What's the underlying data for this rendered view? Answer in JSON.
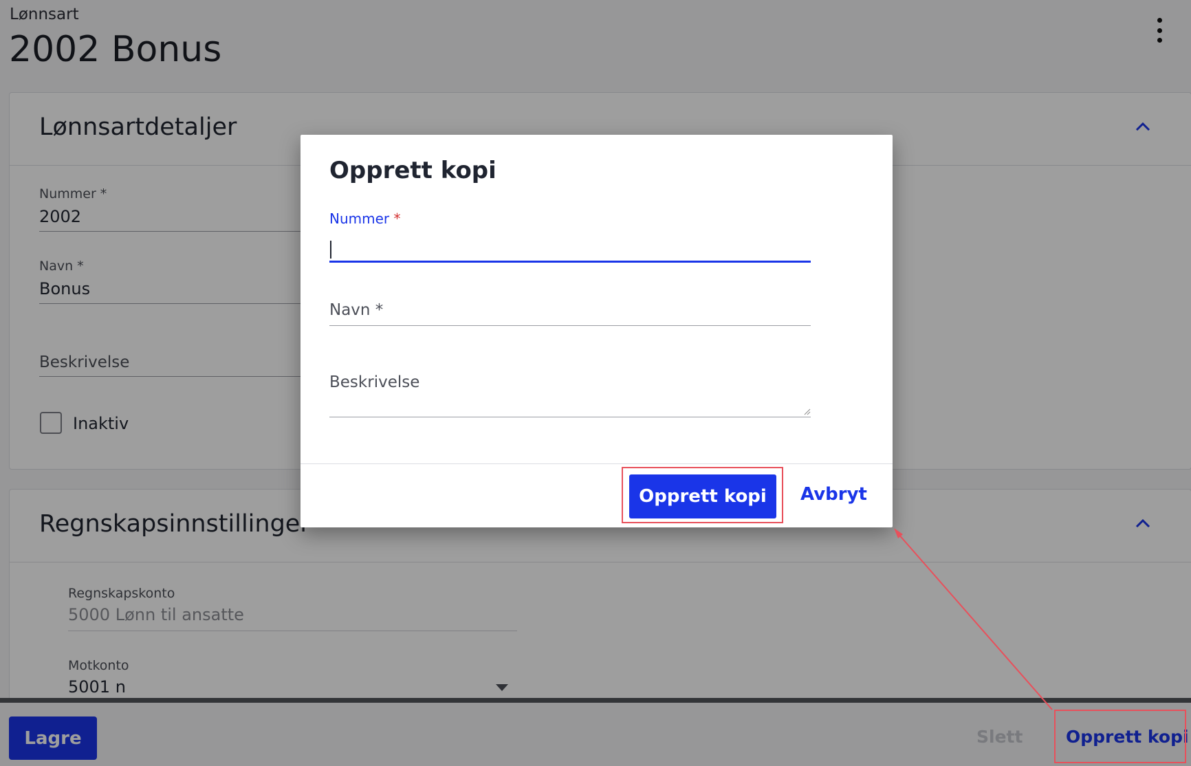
{
  "page": {
    "breadcrumb": "Lønnsart",
    "title": "2002 Bonus"
  },
  "section_details": {
    "title": "Lønnsartdetaljer",
    "nummer_label": "Nummer *",
    "nummer_value": "2002",
    "navn_label": "Navn *",
    "navn_value": "Bonus",
    "beskrivelse_placeholder": "Beskrivelse",
    "inaktiv_label": "Inaktiv",
    "inaktiv_checked": false
  },
  "section_accounting": {
    "title": "Regnskapsinnstillinger",
    "regnskapskonto_label": "Regnskapskonto",
    "regnskapskonto_value": "5000 Lønn til ansatte",
    "motkonto_label": "Motkonto",
    "motkonto_value": "5001 n"
  },
  "footer": {
    "save_label": "Lagre",
    "delete_label": "Slett",
    "copy_label": "Opprett kopi"
  },
  "dialog": {
    "title": "Opprett kopi",
    "nummer_label": "Nummer",
    "nummer_required_mark": "*",
    "nummer_value": "",
    "navn_placeholder": "Navn *",
    "beskrivelse_placeholder": "Beskrivelse",
    "confirm_label": "Opprett kopi",
    "cancel_label": "Avbryt"
  },
  "colors": {
    "primary": "#1a35e8",
    "highlight": "#e8505b",
    "required": "#d32f2f"
  }
}
